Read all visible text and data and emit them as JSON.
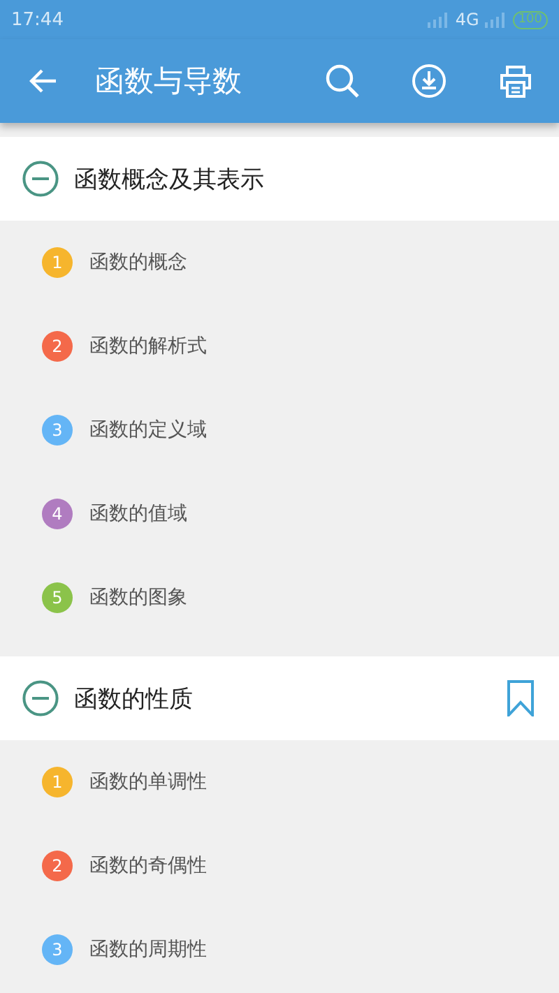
{
  "status_bar": {
    "time": "17:44",
    "network": "4G",
    "battery": "100"
  },
  "app_bar": {
    "title": "函数与导数"
  },
  "sections": [
    {
      "title": "函数概念及其表示",
      "expanded": true,
      "bookmarked": false,
      "items": [
        {
          "number": "1",
          "label": "函数的概念",
          "color": "#f6b52d"
        },
        {
          "number": "2",
          "label": "函数的解析式",
          "color": "#f4694a"
        },
        {
          "number": "3",
          "label": "函数的定义域",
          "color": "#64b5f6"
        },
        {
          "number": "4",
          "label": "函数的值域",
          "color": "#b07cc0"
        },
        {
          "number": "5",
          "label": "函数的图象",
          "color": "#8bc34a"
        }
      ]
    },
    {
      "title": "函数的性质",
      "expanded": true,
      "bookmarked": true,
      "items": [
        {
          "number": "1",
          "label": "函数的单调性",
          "color": "#f6b52d"
        },
        {
          "number": "2",
          "label": "函数的奇偶性",
          "color": "#f4694a"
        },
        {
          "number": "3",
          "label": "函数的周期性",
          "color": "#64b5f6"
        }
      ]
    }
  ]
}
